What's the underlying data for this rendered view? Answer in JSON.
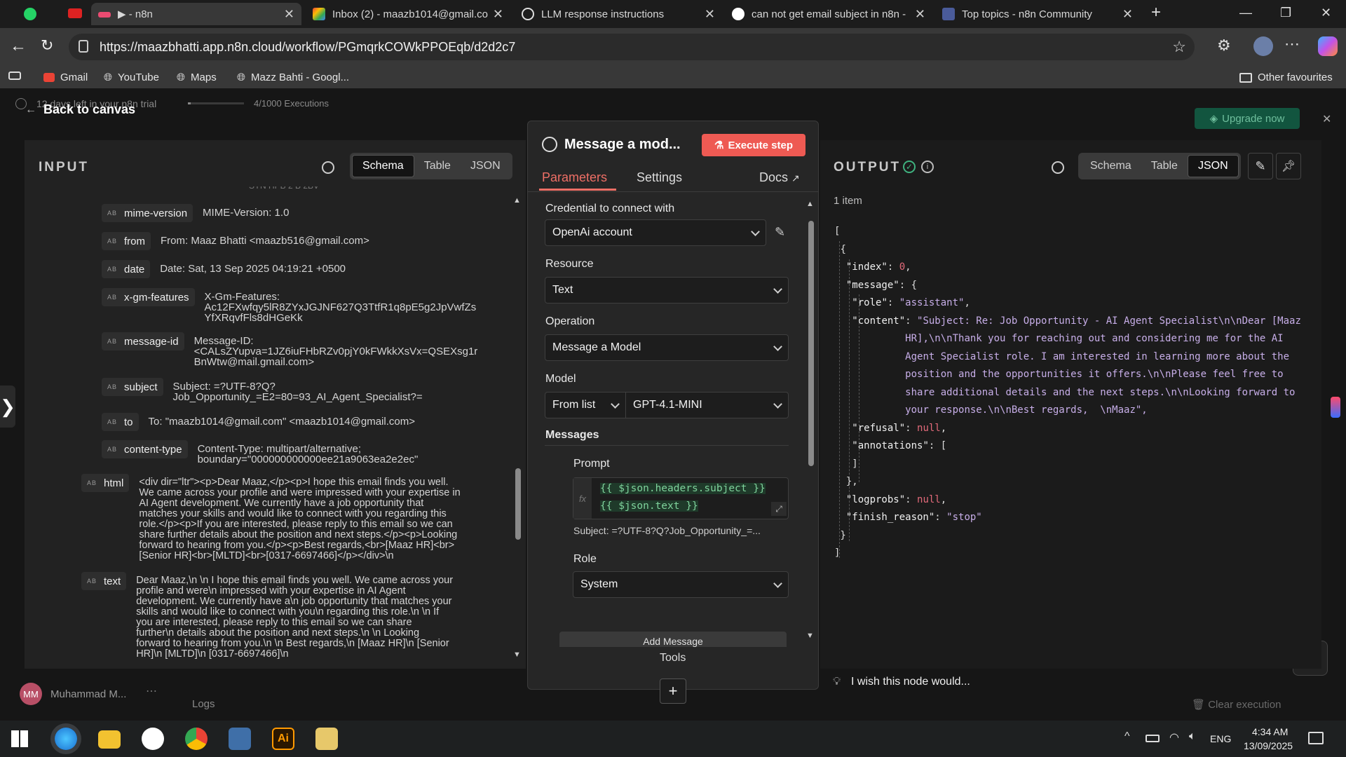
{
  "browser": {
    "tabs": [
      {
        "title": "▶ - n8n",
        "active": true
      },
      {
        "title": "Inbox (2) - maazb1014@gmail.com",
        "active": false
      },
      {
        "title": "LLM response instructions",
        "active": false
      },
      {
        "title": "can not get email subject in n8n -",
        "active": false
      },
      {
        "title": "Top topics - n8n Community",
        "active": false
      }
    ],
    "url": "https://maazbhatti.app.n8n.cloud/workflow/PGmqrkCOWkPPOEqb/d2d2c7",
    "bookmarks": [
      "Gmail",
      "YouTube",
      "Maps",
      "Mazz Bahti - Googl..."
    ],
    "other_favourites": "Other favourites"
  },
  "app": {
    "back_label": "Back to canvas",
    "trial_text": "12 days left in your n8n trial",
    "executions": "4/1000 Executions",
    "upgrade_label": "Upgrade now",
    "user_initials": "MM",
    "user_name": "Muhammad M...",
    "logs_label": "Logs",
    "clear_execution": "Clear execution",
    "wish_text": "I wish this node would..."
  },
  "input": {
    "header": "INPUT",
    "tabs": [
      "Schema",
      "Table",
      "JSON"
    ],
    "active_tab": "Schema",
    "fields": [
      {
        "key": "mime-version",
        "value": "MIME-Version: 1.0"
      },
      {
        "key": "from",
        "value": "From: Maaz Bhatti <maazb516@gmail.com>"
      },
      {
        "key": "date",
        "value": "Date: Sat, 13 Sep 2025 04:19:21 +0500"
      },
      {
        "key": "x-gm-features",
        "value": "X-Gm-Features:\nAc12FXwfqy5lR8ZYxJGJNF627Q3TtfR1q8pE5g2JpVwfZs\nYfXRqvfFls8dHGeKk"
      },
      {
        "key": "message-id",
        "value": "Message-ID:\n<CALsZYupva=1JZ6iuFHbRZv0pjY0kFWkkXsVx=QSEXsg1r\nBnWtw@mail.gmail.com>"
      },
      {
        "key": "subject",
        "value": "Subject: =?UTF-8?Q?\nJob_Opportunity_=E2=80=93_AI_Agent_Specialist?="
      },
      {
        "key": "to",
        "value": "To: \"maazb1014@gmail.com\" <maazb1014@gmail.com>"
      },
      {
        "key": "content-type",
        "value": "Content-Type: multipart/alternative;\nboundary=\"000000000000ee21a9063ea2e2ec\""
      },
      {
        "key": "html",
        "value": "<div dir=\"ltr\"><p>Dear Maaz,</p><p>I hope this email finds you well.\nWe came across your profile and were impressed with your expertise in\nAI Agent development. We currently have a job opportunity that\nmatches your skills and would like to connect with you regarding this\nrole.</p><p>If you are interested, please reply to this email so we can\nshare further details about the position and next steps.</p><p>Looking\nforward to hearing from you.</p><p>Best regards,<br>[Maaz HR]<br>\n[Senior HR]<br>[MLTD]<br>[0317-6697466]</p></div>\\n"
      },
      {
        "key": "text",
        "value": "Dear Maaz,\\n \\n I hope this email finds you well. We came across your\nprofile and were\\n impressed with your expertise in AI Agent\ndevelopment. We currently have a\\n job opportunity that matches your\nskills and would like to connect with you\\n regarding this role.\\n \\n If\nyou are interested, please reply to this email so we can share\nfurther\\n details about the position and next steps.\\n \\n Looking\nforward to hearing from you.\\n \\n Best regards,\\n [Maaz HR]\\n [Senior\nHR]\\n [MLTD]\\n [0317-6697466]\\n"
      }
    ]
  },
  "node": {
    "title": "Message a mod...",
    "execute_label": "Execute step",
    "tabs": [
      "Parameters",
      "Settings"
    ],
    "docs_label": "Docs",
    "credential_label": "Credential to connect with",
    "credential_value": "OpenAi account",
    "resource_label": "Resource",
    "resource_value": "Text",
    "operation_label": "Operation",
    "operation_value": "Message a Model",
    "model_label": "Model",
    "model_mode": "From list",
    "model_value": "GPT-4.1-MINI",
    "messages_label": "Messages",
    "prompt_label": "Prompt",
    "prompt_line1": "{{ $json.headers.subject }}",
    "prompt_line2": "{{ $json.text }}",
    "prompt_preview": "Subject: =?UTF-8?Q?Job_Opportunity_=...",
    "role_label": "Role",
    "role_value": "System",
    "add_message": "Add Message",
    "tools_label": "Tools",
    "fx_label": "fx"
  },
  "output": {
    "header": "OUTPUT",
    "tabs": [
      "Schema",
      "Table",
      "JSON"
    ],
    "active_tab": "JSON",
    "item_count": "1 item",
    "index": "0",
    "role": "\"assistant\"",
    "content_lines": [
      "\"Subject: Re: Job Opportunity - AI Agent Specialist\\n\\nDear [Maaz",
      "HR],\\n\\nThank you for reaching out and considering me for the AI",
      "Agent Specialist role. I am interested in learning more about the",
      "position and the opportunities it offers.\\n\\nPlease feel free to",
      "share additional details and the next steps.\\n\\nLooking forward to",
      "your response.\\n\\nBest regards,  \\nMaaz\","
    ],
    "refusal": "null",
    "logprobs": "null",
    "finish_reason": "\"stop\""
  },
  "taskbar": {
    "lang": "ENG",
    "time": "4:34 AM",
    "date": "13/09/2025"
  }
}
